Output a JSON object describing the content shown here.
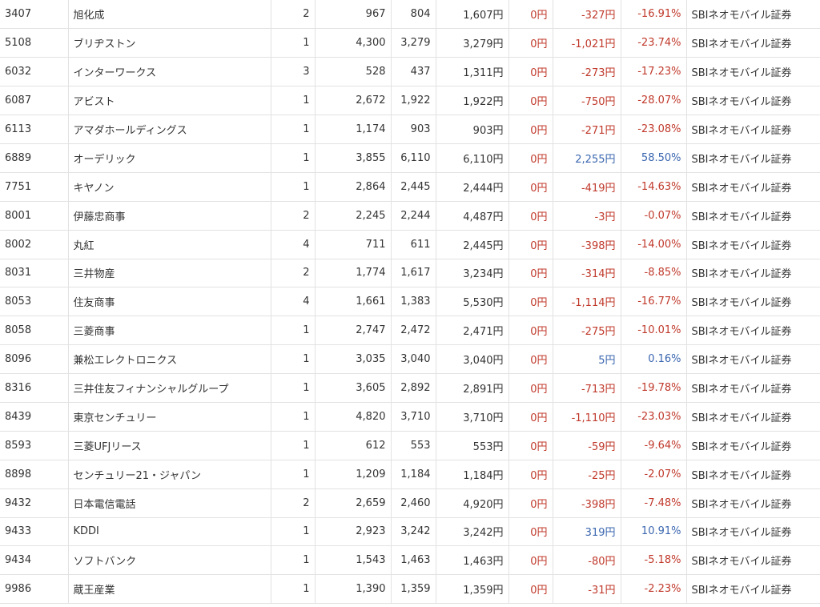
{
  "rows": [
    {
      "code": "3407",
      "name": "旭化成",
      "qty": "2",
      "cost": "967",
      "price": "804",
      "value": "1,607円",
      "dividend": "0円",
      "pl": "-327円",
      "pl_pct": "-16.91%",
      "broker": "SBIネオモバイル証券",
      "status": "loss"
    },
    {
      "code": "5108",
      "name": "ブリヂストン",
      "qty": "1",
      "cost": "4,300",
      "price": "3,279",
      "value": "3,279円",
      "dividend": "0円",
      "pl": "-1,021円",
      "pl_pct": "-23.74%",
      "broker": "SBIネオモバイル証券",
      "status": "loss"
    },
    {
      "code": "6032",
      "name": "インターワークス",
      "qty": "3",
      "cost": "528",
      "price": "437",
      "value": "1,311円",
      "dividend": "0円",
      "pl": "-273円",
      "pl_pct": "-17.23%",
      "broker": "SBIネオモバイル証券",
      "status": "loss"
    },
    {
      "code": "6087",
      "name": "アビスト",
      "qty": "1",
      "cost": "2,672",
      "price": "1,922",
      "value": "1,922円",
      "dividend": "0円",
      "pl": "-750円",
      "pl_pct": "-28.07%",
      "broker": "SBIネオモバイル証券",
      "status": "loss"
    },
    {
      "code": "6113",
      "name": "アマダホールディングス",
      "qty": "1",
      "cost": "1,174",
      "price": "903",
      "value": "903円",
      "dividend": "0円",
      "pl": "-271円",
      "pl_pct": "-23.08%",
      "broker": "SBIネオモバイル証券",
      "status": "loss"
    },
    {
      "code": "6889",
      "name": "オーデリック",
      "qty": "1",
      "cost": "3,855",
      "price": "6,110",
      "value": "6,110円",
      "dividend": "0円",
      "pl": "2,255円",
      "pl_pct": "58.50%",
      "broker": "SBIネオモバイル証券",
      "status": "gain"
    },
    {
      "code": "7751",
      "name": "キヤノン",
      "qty": "1",
      "cost": "2,864",
      "price": "2,445",
      "value": "2,444円",
      "dividend": "0円",
      "pl": "-419円",
      "pl_pct": "-14.63%",
      "broker": "SBIネオモバイル証券",
      "status": "loss"
    },
    {
      "code": "8001",
      "name": "伊藤忠商事",
      "qty": "2",
      "cost": "2,245",
      "price": "2,244",
      "value": "4,487円",
      "dividend": "0円",
      "pl": "-3円",
      "pl_pct": "-0.07%",
      "broker": "SBIネオモバイル証券",
      "status": "loss"
    },
    {
      "code": "8002",
      "name": "丸紅",
      "qty": "4",
      "cost": "711",
      "price": "611",
      "value": "2,445円",
      "dividend": "0円",
      "pl": "-398円",
      "pl_pct": "-14.00%",
      "broker": "SBIネオモバイル証券",
      "status": "loss"
    },
    {
      "code": "8031",
      "name": "三井物産",
      "qty": "2",
      "cost": "1,774",
      "price": "1,617",
      "value": "3,234円",
      "dividend": "0円",
      "pl": "-314円",
      "pl_pct": "-8.85%",
      "broker": "SBIネオモバイル証券",
      "status": "loss"
    },
    {
      "code": "8053",
      "name": "住友商事",
      "qty": "4",
      "cost": "1,661",
      "price": "1,383",
      "value": "5,530円",
      "dividend": "0円",
      "pl": "-1,114円",
      "pl_pct": "-16.77%",
      "broker": "SBIネオモバイル証券",
      "status": "loss"
    },
    {
      "code": "8058",
      "name": "三菱商事",
      "qty": "1",
      "cost": "2,747",
      "price": "2,472",
      "value": "2,471円",
      "dividend": "0円",
      "pl": "-275円",
      "pl_pct": "-10.01%",
      "broker": "SBIネオモバイル証券",
      "status": "loss"
    },
    {
      "code": "8096",
      "name": "兼松エレクトロニクス",
      "qty": "1",
      "cost": "3,035",
      "price": "3,040",
      "value": "3,040円",
      "dividend": "0円",
      "pl": "5円",
      "pl_pct": "0.16%",
      "broker": "SBIネオモバイル証券",
      "status": "gain"
    },
    {
      "code": "8316",
      "name": "三井住友フィナンシャルグループ",
      "qty": "1",
      "cost": "3,605",
      "price": "2,892",
      "value": "2,891円",
      "dividend": "0円",
      "pl": "-713円",
      "pl_pct": "-19.78%",
      "broker": "SBIネオモバイル証券",
      "status": "loss"
    },
    {
      "code": "8439",
      "name": "東京センチュリー",
      "qty": "1",
      "cost": "4,820",
      "price": "3,710",
      "value": "3,710円",
      "dividend": "0円",
      "pl": "-1,110円",
      "pl_pct": "-23.03%",
      "broker": "SBIネオモバイル証券",
      "status": "loss"
    },
    {
      "code": "8593",
      "name": "三菱UFJリース",
      "qty": "1",
      "cost": "612",
      "price": "553",
      "value": "553円",
      "dividend": "0円",
      "pl": "-59円",
      "pl_pct": "-9.64%",
      "broker": "SBIネオモバイル証券",
      "status": "loss"
    },
    {
      "code": "8898",
      "name": "センチュリー21・ジャパン",
      "qty": "1",
      "cost": "1,209",
      "price": "1,184",
      "value": "1,184円",
      "dividend": "0円",
      "pl": "-25円",
      "pl_pct": "-2.07%",
      "broker": "SBIネオモバイル証券",
      "status": "loss"
    },
    {
      "code": "9432",
      "name": "日本電信電話",
      "qty": "2",
      "cost": "2,659",
      "price": "2,460",
      "value": "4,920円",
      "dividend": "0円",
      "pl": "-398円",
      "pl_pct": "-7.48%",
      "broker": "SBIネオモバイル証券",
      "status": "loss"
    },
    {
      "code": "9433",
      "name": "KDDI",
      "qty": "1",
      "cost": "2,923",
      "price": "3,242",
      "value": "3,242円",
      "dividend": "0円",
      "pl": "319円",
      "pl_pct": "10.91%",
      "broker": "SBIネオモバイル証券",
      "status": "gain"
    },
    {
      "code": "9434",
      "name": "ソフトバンク",
      "qty": "1",
      "cost": "1,543",
      "price": "1,463",
      "value": "1,463円",
      "dividend": "0円",
      "pl": "-80円",
      "pl_pct": "-5.18%",
      "broker": "SBIネオモバイル証券",
      "status": "loss"
    },
    {
      "code": "9986",
      "name": "蔵王産業",
      "qty": "1",
      "cost": "1,390",
      "price": "1,359",
      "value": "1,359円",
      "dividend": "0円",
      "pl": "-31円",
      "pl_pct": "-2.23%",
      "broker": "SBIネオモバイル証券",
      "status": "loss"
    }
  ],
  "colors": {
    "loss": "#c0392b",
    "gain": "#3b67b0",
    "text": "#333333",
    "border": "#e2e2e2"
  }
}
